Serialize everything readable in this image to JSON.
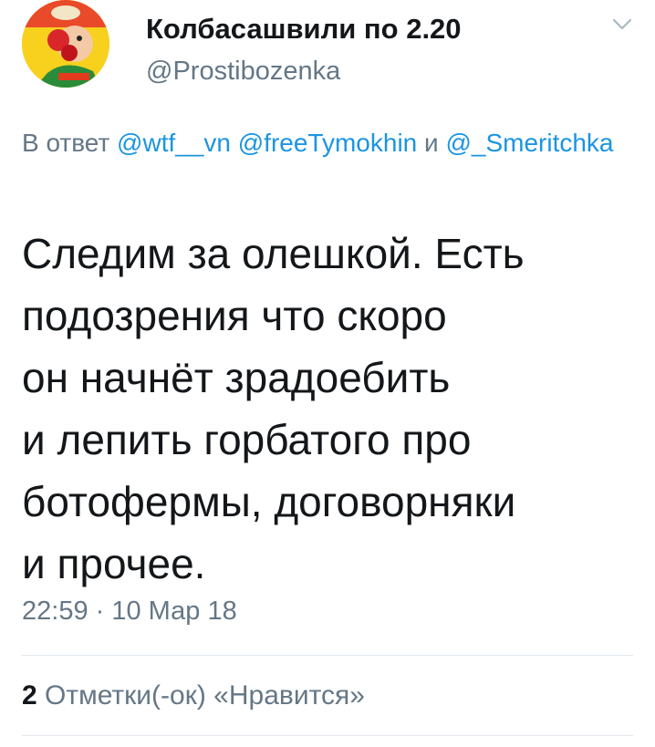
{
  "author": {
    "display_name": "Колбасашвили по 2.20",
    "handle": "@Prostibozenka",
    "avatar_icon": "clown-avatar-icon"
  },
  "menu": {
    "icon": "chevron-down-icon"
  },
  "reply": {
    "prefix": "В ответ",
    "mentions": [
      "@wtf__vn",
      "@freeTymokhin",
      "@_Smeritchka"
    ],
    "conjunction": "и"
  },
  "tweet": {
    "lines": [
      "Следим за олешкой. Есть",
      "подозрения что скоро",
      "он начнёт зрадоебить",
      "и лепить горбатого про",
      "ботофермы, договорняки",
      "и прочее."
    ],
    "timestamp": "22:59 · 10 Мар 18"
  },
  "stats": {
    "likes_count": "2",
    "likes_label": "Отметки(-ок) «Нравится»"
  },
  "colors": {
    "text": "#14171a",
    "secondary": "#657786",
    "link": "#1b95e0",
    "divider": "#e1e8ed"
  }
}
